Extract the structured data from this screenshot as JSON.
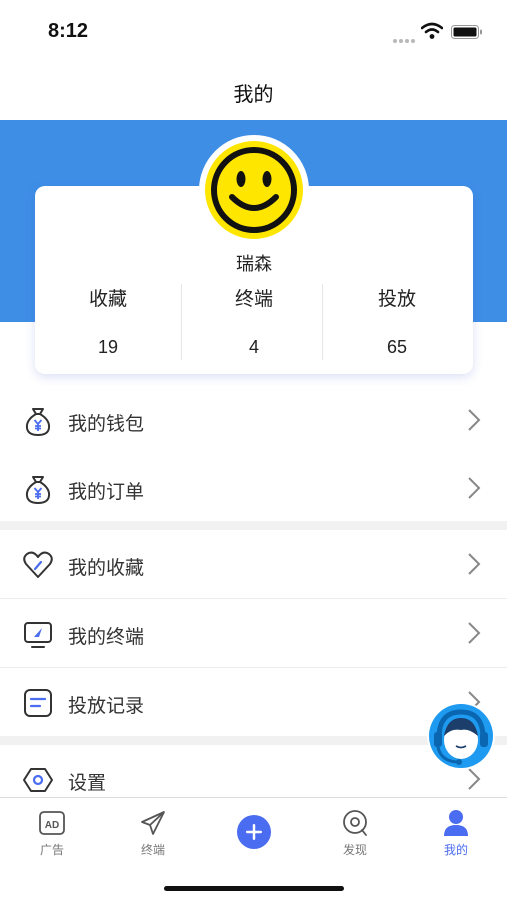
{
  "status_bar": {
    "time": "8:12"
  },
  "nav": {
    "title": "我的"
  },
  "profile": {
    "username": "瑞森",
    "stats": [
      {
        "label": "收藏",
        "value": "19"
      },
      {
        "label": "终端",
        "value": "4"
      },
      {
        "label": "投放",
        "value": "65"
      }
    ]
  },
  "menu": {
    "wallet": "我的钱包",
    "orders": "我的订单",
    "favorites": "我的收藏",
    "terminals": "我的终端",
    "records": "投放记录",
    "settings": "设置"
  },
  "tab_bar": {
    "tabs": [
      {
        "label": "广告",
        "icon": "ad-icon"
      },
      {
        "label": "终端",
        "icon": "paper-plane-icon"
      },
      {
        "label": "",
        "icon": "plus-icon"
      },
      {
        "label": "发现",
        "icon": "discover-icon"
      },
      {
        "label": "我的",
        "icon": "user-icon"
      }
    ],
    "active_index": 4
  },
  "colors": {
    "header_blue": "#3e8ee6",
    "accent": "#4a6cf0",
    "avatar_yellow": "#ffe600"
  }
}
